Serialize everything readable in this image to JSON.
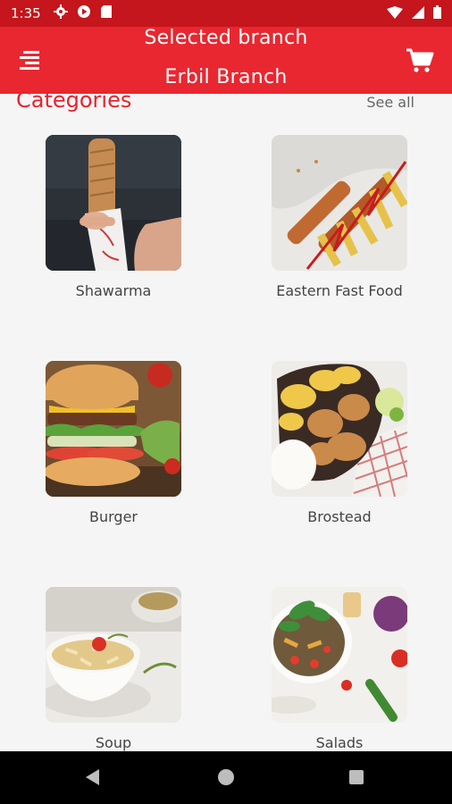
{
  "status_bar": {
    "time": "1:35",
    "icons": [
      "gear-icon",
      "play-icon",
      "sd-card-icon",
      "wifi-icon",
      "signal-icon",
      "battery-icon"
    ]
  },
  "app_bar": {
    "title_line1": "Selected branch",
    "title_line2": "Erbil Branch",
    "menu_icon": "menu-icon",
    "cart_icon": "cart-icon",
    "accent": "#e92730"
  },
  "categories_section": {
    "title": "Categories",
    "see_all": "See all",
    "title_color": "#e8232c"
  },
  "categories": [
    {
      "name": "Shawarma"
    },
    {
      "name": "Eastern Fast Food"
    },
    {
      "name": "Burger"
    },
    {
      "name": "Brostead"
    },
    {
      "name": "Soup"
    },
    {
      "name": "Salads"
    }
  ],
  "nav_bar": {
    "icons": [
      "back-icon",
      "home-icon",
      "recents-icon"
    ]
  }
}
